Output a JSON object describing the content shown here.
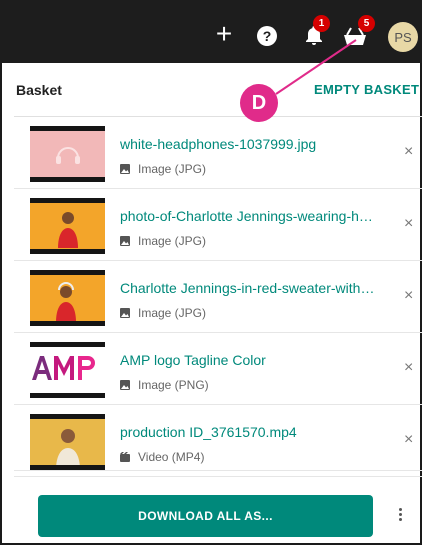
{
  "topbar": {
    "notifications_count": "1",
    "basket_count": "5",
    "avatar_initials": "PS",
    "help_glyph": "?"
  },
  "panel": {
    "title": "Basket",
    "empty_label": "EMPTY BASKET",
    "callout_letter": "D"
  },
  "items": [
    {
      "name": "white-headphones-1037999.jpg",
      "type": "Image (JPG)",
      "icon": "image-icon",
      "thumb": "pink-headphones"
    },
    {
      "name": "photo-of-Charlotte Jennings-wearing-headphones.jpg",
      "type": "Image (JPG)",
      "icon": "image-icon",
      "thumb": "orange-person"
    },
    {
      "name": "Charlotte Jennings-in-red-sweater-with-headphones.jpg",
      "type": "Image (JPG)",
      "icon": "image-icon",
      "thumb": "orange-person"
    },
    {
      "name": "AMP logo Tagline Color",
      "type": "Image (PNG)",
      "icon": "image-icon",
      "thumb": "amp-logo"
    },
    {
      "name": "production ID_3761570.mp4",
      "type": "Video (MP4)",
      "icon": "video-icon",
      "thumb": "yellow-person"
    }
  ],
  "footer": {
    "download_label": "DOWNLOAD ALL AS..."
  },
  "colors": {
    "accent": "#00897b",
    "topbar": "#1d1d1d",
    "badge": "#d50000",
    "callout": "#e02b8a",
    "avatar": "#e8d8a6"
  }
}
